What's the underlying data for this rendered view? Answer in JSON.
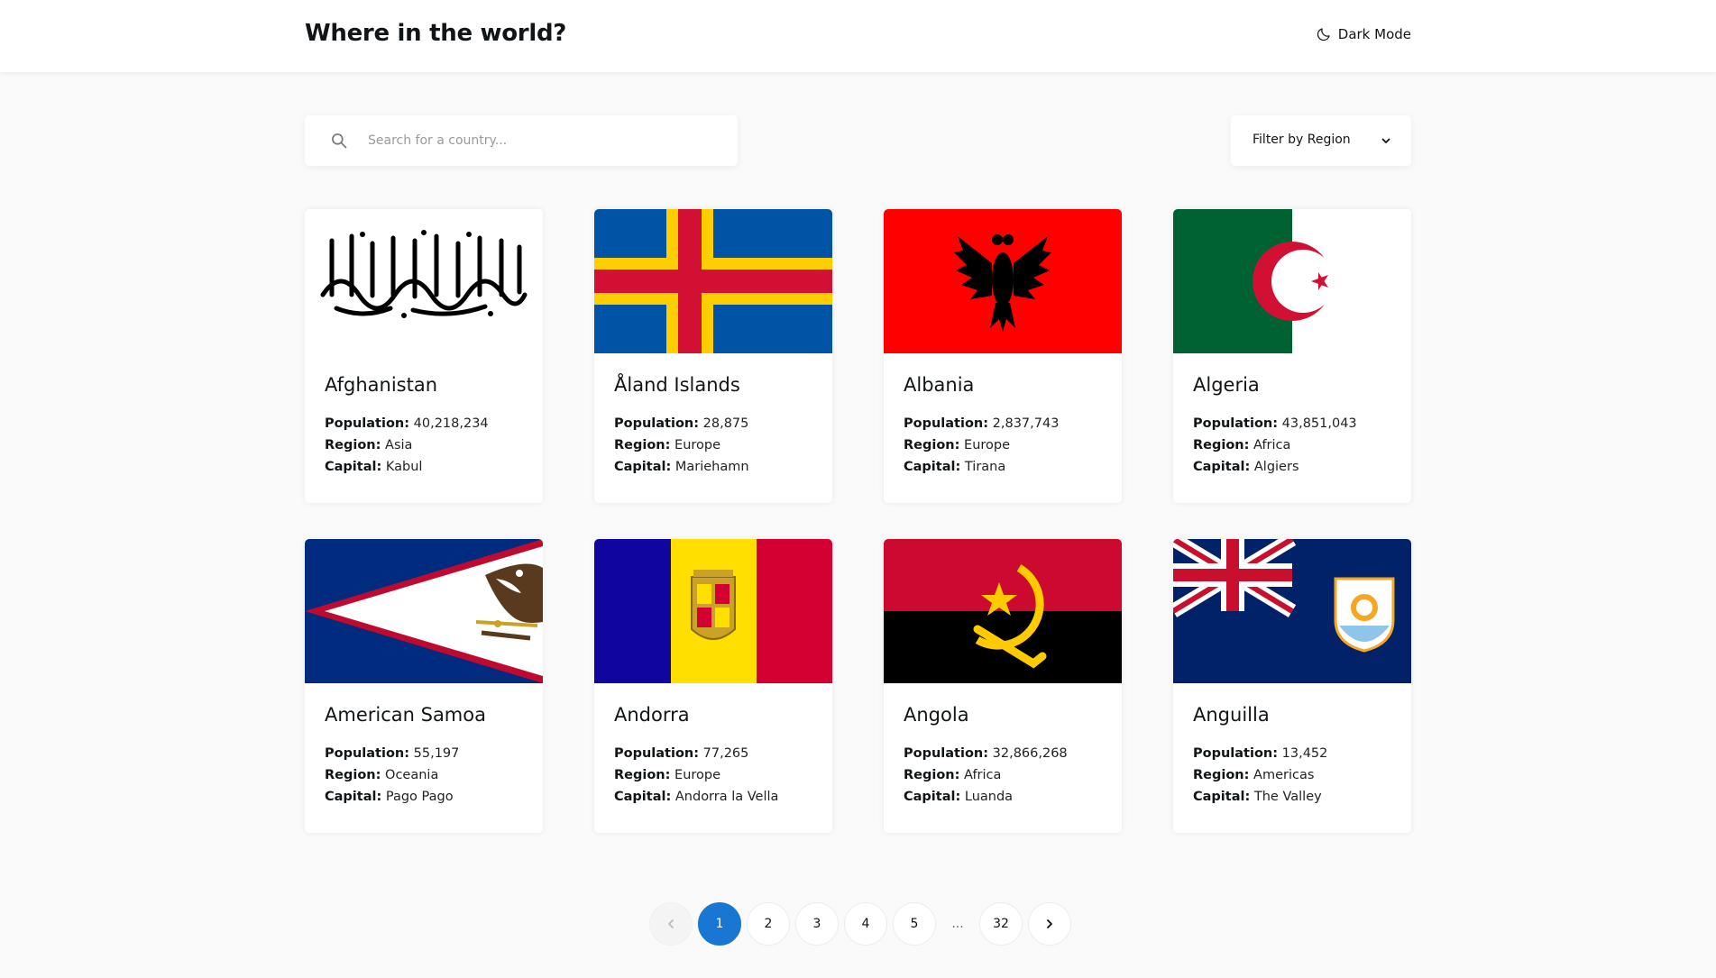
{
  "header": {
    "title": "Where in the world?",
    "theme_toggle_label": "Dark Mode",
    "theme_icon": "moon-icon"
  },
  "search": {
    "placeholder": "Search for a country...",
    "value": "",
    "icon": "search-icon"
  },
  "filter": {
    "label": "Filter by Region",
    "icon": "chevron-down-icon"
  },
  "field_labels": {
    "population": "Population:",
    "region": "Region:",
    "capital": "Capital:"
  },
  "countries": [
    {
      "name": "Afghanistan",
      "population": "40,218,234",
      "region": "Asia",
      "capital": "Kabul"
    },
    {
      "name": "Åland Islands",
      "population": "28,875",
      "region": "Europe",
      "capital": "Mariehamn"
    },
    {
      "name": "Albania",
      "population": "2,837,743",
      "region": "Europe",
      "capital": "Tirana"
    },
    {
      "name": "Algeria",
      "population": "43,851,043",
      "region": "Africa",
      "capital": "Algiers"
    },
    {
      "name": "American Samoa",
      "population": "55,197",
      "region": "Oceania",
      "capital": "Pago Pago"
    },
    {
      "name": "Andorra",
      "population": "77,265",
      "region": "Europe",
      "capital": "Andorra la Vella"
    },
    {
      "name": "Angola",
      "population": "32,866,268",
      "region": "Africa",
      "capital": "Luanda"
    },
    {
      "name": "Anguilla",
      "population": "13,452",
      "region": "Americas",
      "capital": "The Valley"
    }
  ],
  "pagination": {
    "pages": [
      "1",
      "2",
      "3",
      "4",
      "5"
    ],
    "ellipsis": "...",
    "last_page": "32",
    "current": "1"
  },
  "colors": {
    "background": "#fafafa",
    "surface": "#ffffff",
    "text": "#111517",
    "accent": "#1976d2"
  }
}
